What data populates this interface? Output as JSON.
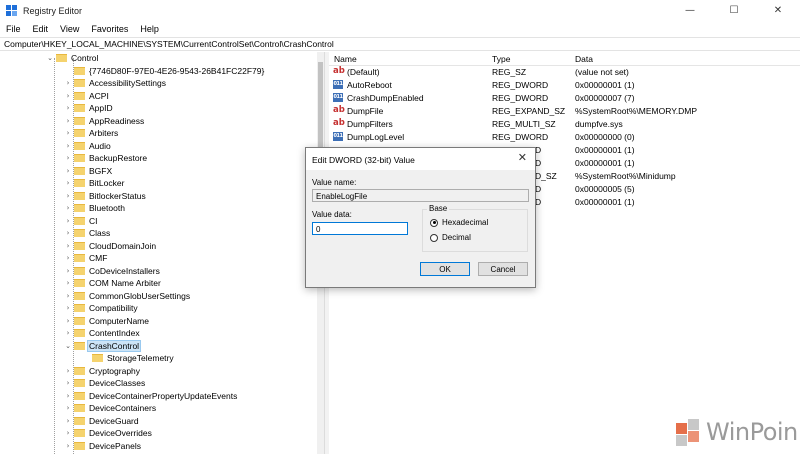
{
  "window": {
    "title": "Registry Editor",
    "controls": [
      "—",
      "☐",
      "✕"
    ]
  },
  "menu": [
    "File",
    "Edit",
    "View",
    "Favorites",
    "Help"
  ],
  "address": "Computer\\HKEY_LOCAL_MACHINE\\SYSTEM\\CurrentControlSet\\Control\\CrashControl",
  "tree": {
    "root": "Control",
    "items": [
      {
        "label": "{7746D80F-97E0-4E26-9543-26B41FC22F79}",
        "arrow": ""
      },
      {
        "label": "AccessibilitySettings",
        "arrow": "›"
      },
      {
        "label": "ACPI",
        "arrow": "›"
      },
      {
        "label": "AppID",
        "arrow": "›"
      },
      {
        "label": "AppReadiness",
        "arrow": "›"
      },
      {
        "label": "Arbiters",
        "arrow": "›"
      },
      {
        "label": "Audio",
        "arrow": "›"
      },
      {
        "label": "BackupRestore",
        "arrow": "›"
      },
      {
        "label": "BGFX",
        "arrow": "›"
      },
      {
        "label": "BitLocker",
        "arrow": "›"
      },
      {
        "label": "BitlockerStatus",
        "arrow": "›"
      },
      {
        "label": "Bluetooth",
        "arrow": "›"
      },
      {
        "label": "CI",
        "arrow": "›"
      },
      {
        "label": "Class",
        "arrow": "›"
      },
      {
        "label": "CloudDomainJoin",
        "arrow": "›"
      },
      {
        "label": "CMF",
        "arrow": "›"
      },
      {
        "label": "CoDeviceInstallers",
        "arrow": "›"
      },
      {
        "label": "COM Name Arbiter",
        "arrow": "›"
      },
      {
        "label": "CommonGlobUserSettings",
        "arrow": "›"
      },
      {
        "label": "Compatibility",
        "arrow": "›"
      },
      {
        "label": "ComputerName",
        "arrow": "›"
      },
      {
        "label": "ContentIndex",
        "arrow": "›"
      },
      {
        "label": "CrashControl",
        "arrow": "⌄",
        "selected": true
      },
      {
        "label": "StorageTelemetry",
        "arrow": "",
        "child": true
      },
      {
        "label": "Cryptography",
        "arrow": "›"
      },
      {
        "label": "DeviceClasses",
        "arrow": "›"
      },
      {
        "label": "DeviceContainerPropertyUpdateEvents",
        "arrow": "›"
      },
      {
        "label": "DeviceContainers",
        "arrow": "›"
      },
      {
        "label": "DeviceGuard",
        "arrow": "›"
      },
      {
        "label": "DeviceOverrides",
        "arrow": "›"
      },
      {
        "label": "DevicePanels",
        "arrow": "›"
      }
    ]
  },
  "values": {
    "headers": {
      "name": "Name",
      "type": "Type",
      "data": "Data"
    },
    "rows": [
      {
        "icon": "ab",
        "name": "(Default)",
        "type": "REG_SZ",
        "data": "(value not set)"
      },
      {
        "icon": "011",
        "name": "AutoReboot",
        "type": "REG_DWORD",
        "data": "0x00000001 (1)"
      },
      {
        "icon": "011",
        "name": "CrashDumpEnabled",
        "type": "REG_DWORD",
        "data": "0x00000007 (7)"
      },
      {
        "icon": "ab",
        "name": "DumpFile",
        "type": "REG_EXPAND_SZ",
        "data": "%SystemRoot%\\MEMORY.DMP"
      },
      {
        "icon": "ab",
        "name": "DumpFilters",
        "type": "REG_MULTI_SZ",
        "data": "dumpfve.sys"
      },
      {
        "icon": "011",
        "name": "DumpLogLevel",
        "type": "REG_DWORD",
        "data": "0x00000000 (0)"
      },
      {
        "icon": "",
        "name": "",
        "type": "D",
        "data": "0x00000001 (1)"
      },
      {
        "icon": "",
        "name": "",
        "type": "D",
        "data": "0x00000001 (1)"
      },
      {
        "icon": "",
        "name": "",
        "type": "D_SZ",
        "data": "%SystemRoot%\\Minidump"
      },
      {
        "icon": "",
        "name": "",
        "type": "D",
        "data": "0x00000005 (5)"
      },
      {
        "icon": "",
        "name": "",
        "type": "D",
        "data": "0x00000001 (1)"
      }
    ]
  },
  "dialog": {
    "title": "Edit DWORD (32-bit) Value",
    "close": "✕",
    "value_name_label": "Value name:",
    "value_name": "EnableLogFile",
    "value_data_label": "Value data:",
    "value_data": "0",
    "base_label": "Base",
    "hex_label": "Hexadecimal",
    "dec_label": "Decimal",
    "ok": "OK",
    "cancel": "Cancel"
  },
  "watermark": "WinPoin",
  "colors": {
    "selection": "#cce4f7",
    "accent": "#0078d7",
    "folder": "#f5d36e"
  }
}
